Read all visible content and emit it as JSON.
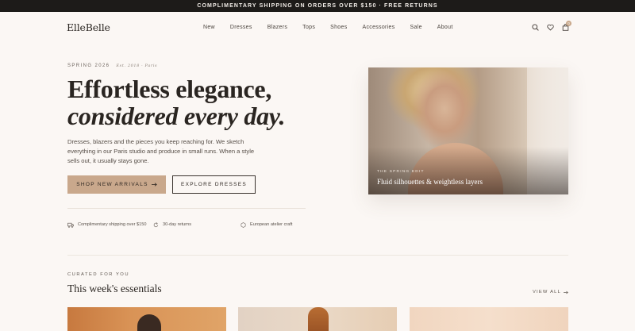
{
  "announcement": "COMPLIMENTARY SHIPPING ON ORDERS OVER $150 · FREE RETURNS",
  "header": {
    "logo": "ElleBelle",
    "nav": [
      "New",
      "Dresses",
      "Blazers",
      "Tops",
      "Shoes",
      "Accessories",
      "Sale",
      "About"
    ],
    "icons": [
      "search-icon",
      "heart-icon",
      "bag-icon"
    ],
    "cart_count": "0"
  },
  "hero": {
    "eyebrow": "SPRING 2026",
    "eyebrow_sub": "Est. 2018 · Paris",
    "headline_line1": "Effortless elegance,",
    "headline_line2": "considered every day.",
    "lede": "Dresses, blazers and the pieces you keep reaching for. We sketch everything in our Paris studio and produce in small runs. When a style sells out, it usually stays gone.",
    "primary_button": "SHOP NEW ARRIVALS",
    "secondary_button": "EXPLORE DRESSES",
    "perks": [
      {
        "icon": "truck-icon",
        "text": "Complimentary shipping over $150"
      },
      {
        "icon": "return-icon",
        "text": "30-day returns"
      },
      {
        "icon": "hexagon-icon",
        "text": "European atelier craft"
      }
    ],
    "card": {
      "tag": "THE SPRING EDIT",
      "caption": "Fluid silhouettes & weightless layers"
    }
  },
  "curated": {
    "eyebrow": "CURATED FOR YOU",
    "title": "This week's essentials",
    "view_all": "VIEW ALL"
  },
  "colors": {
    "accent": "#c9a88c",
    "background": "#fbf7f4",
    "announcement_bg": "#1d1b19"
  }
}
